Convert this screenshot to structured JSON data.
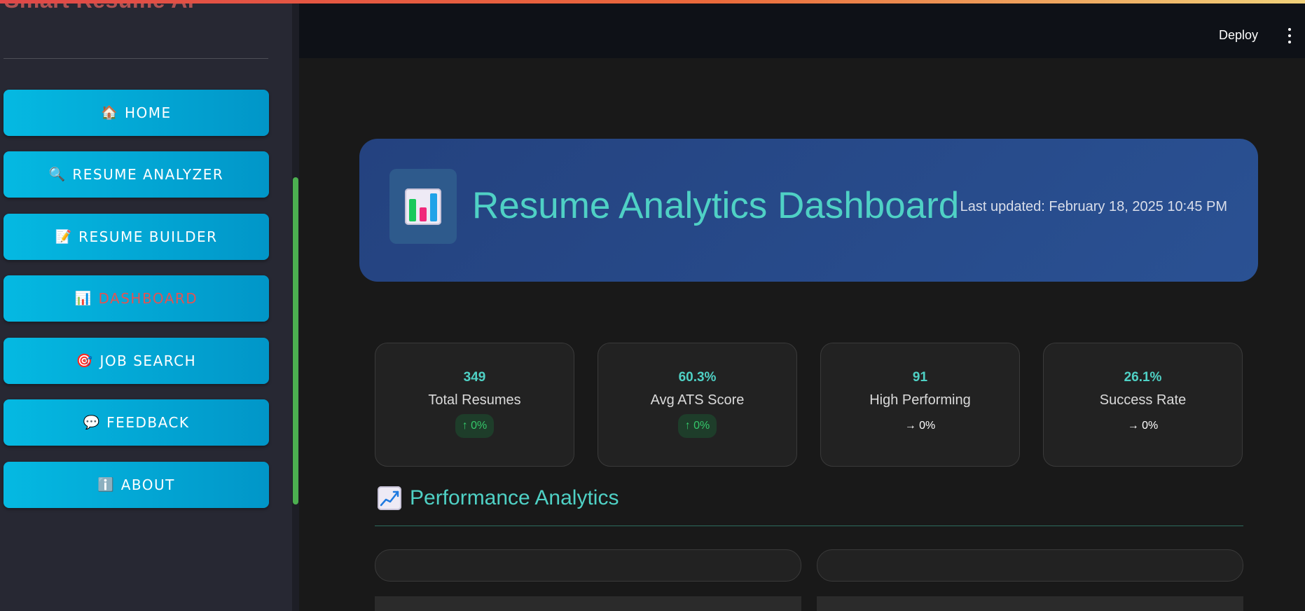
{
  "app": {
    "title": "Smart Resume AI"
  },
  "sidebar": {
    "items": [
      {
        "label": "HOME",
        "icon": "house-icon",
        "glyph": "🏠"
      },
      {
        "label": "RESUME ANALYZER",
        "icon": "magnifier-icon",
        "glyph": "🔍"
      },
      {
        "label": "RESUME BUILDER",
        "icon": "memo-icon",
        "glyph": "📝"
      },
      {
        "label": "DASHBOARD",
        "icon": "bar-chart-icon",
        "glyph": "📊",
        "active": true
      },
      {
        "label": "JOB SEARCH",
        "icon": "target-icon",
        "glyph": "🎯"
      },
      {
        "label": "FEEDBACK",
        "icon": "speech-bubble-icon",
        "glyph": "💬"
      },
      {
        "label": "ABOUT",
        "icon": "info-icon",
        "glyph": "ℹ️"
      }
    ]
  },
  "header": {
    "deploy_label": "Deploy"
  },
  "hero": {
    "title": "Resume Analytics Dashboard",
    "last_updated": "Last updated: February 18, 2025 10:45 PM"
  },
  "stats": [
    {
      "value": "349",
      "label": "Total Resumes",
      "delta": "↑ 0%",
      "delta_type": "up"
    },
    {
      "value": "60.3%",
      "label": "Avg ATS Score",
      "delta": "↑ 0%",
      "delta_type": "up"
    },
    {
      "value": "91",
      "label": "High Performing",
      "delta": "→ 0%",
      "delta_type": "neutral"
    },
    {
      "value": "26.1%",
      "label": "Success Rate",
      "delta": "→ 0%",
      "delta_type": "neutral"
    }
  ],
  "performance": {
    "title": "Performance Analytics"
  },
  "colors": {
    "accent_teal": "#4fd1c5",
    "nav_button": "#05b9e2",
    "active_label": "#e25353",
    "hero_bg": "#2a5193",
    "delta_up": "#35c76a",
    "scrollbar": "#4caf50"
  }
}
